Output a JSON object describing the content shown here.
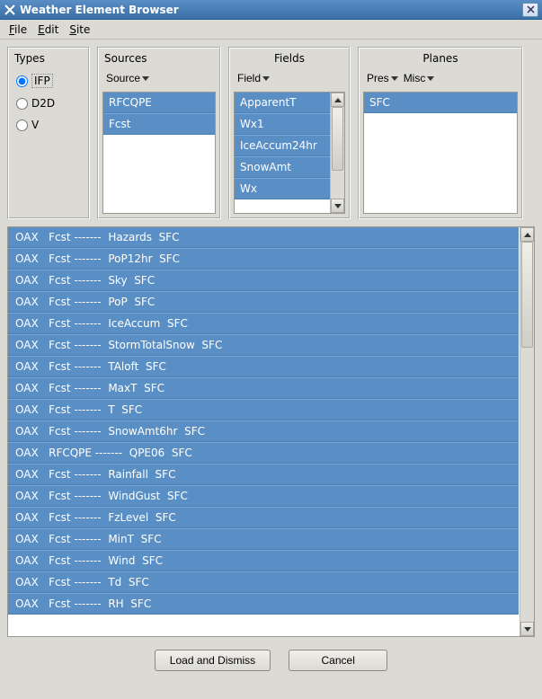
{
  "window": {
    "title": "Weather Element Browser"
  },
  "menu": {
    "file": "File",
    "edit": "Edit",
    "site": "Site"
  },
  "types": {
    "label": "Types",
    "options": {
      "ifp": "IFP",
      "d2d": "D2D",
      "v": "V"
    },
    "selected": "ifp"
  },
  "sources": {
    "label": "Sources",
    "dropdown": "Source",
    "items": [
      "RFCQPE",
      "Fcst"
    ]
  },
  "fields": {
    "label": "Fields",
    "dropdown": "Field",
    "items": [
      "ApparentT",
      "Wx1",
      "IceAccum24hr",
      "SnowAmt",
      "Wx"
    ]
  },
  "planes": {
    "label": "Planes",
    "dropdown1": "Pres",
    "dropdown2": "Misc",
    "items": [
      "SFC"
    ]
  },
  "results": [
    "OAX   Fcst -------  Hazards  SFC",
    "OAX   Fcst -------  PoP12hr  SFC",
    "OAX   Fcst -------  Sky  SFC",
    "OAX   Fcst -------  PoP  SFC",
    "OAX   Fcst -------  IceAccum  SFC",
    "OAX   Fcst -------  StormTotalSnow  SFC",
    "OAX   Fcst -------  TAloft  SFC",
    "OAX   Fcst -------  MaxT  SFC",
    "OAX   Fcst -------  T  SFC",
    "OAX   Fcst -------  SnowAmt6hr  SFC",
    "OAX   RFCQPE -------  QPE06  SFC",
    "OAX   Fcst -------  Rainfall  SFC",
    "OAX   Fcst -------  WindGust  SFC",
    "OAX   Fcst -------  FzLevel  SFC",
    "OAX   Fcst -------  MinT  SFC",
    "OAX   Fcst -------  Wind  SFC",
    "OAX   Fcst -------  Td  SFC",
    "OAX   Fcst -------  RH  SFC"
  ],
  "buttons": {
    "load": "Load and Dismiss",
    "cancel": "Cancel"
  }
}
